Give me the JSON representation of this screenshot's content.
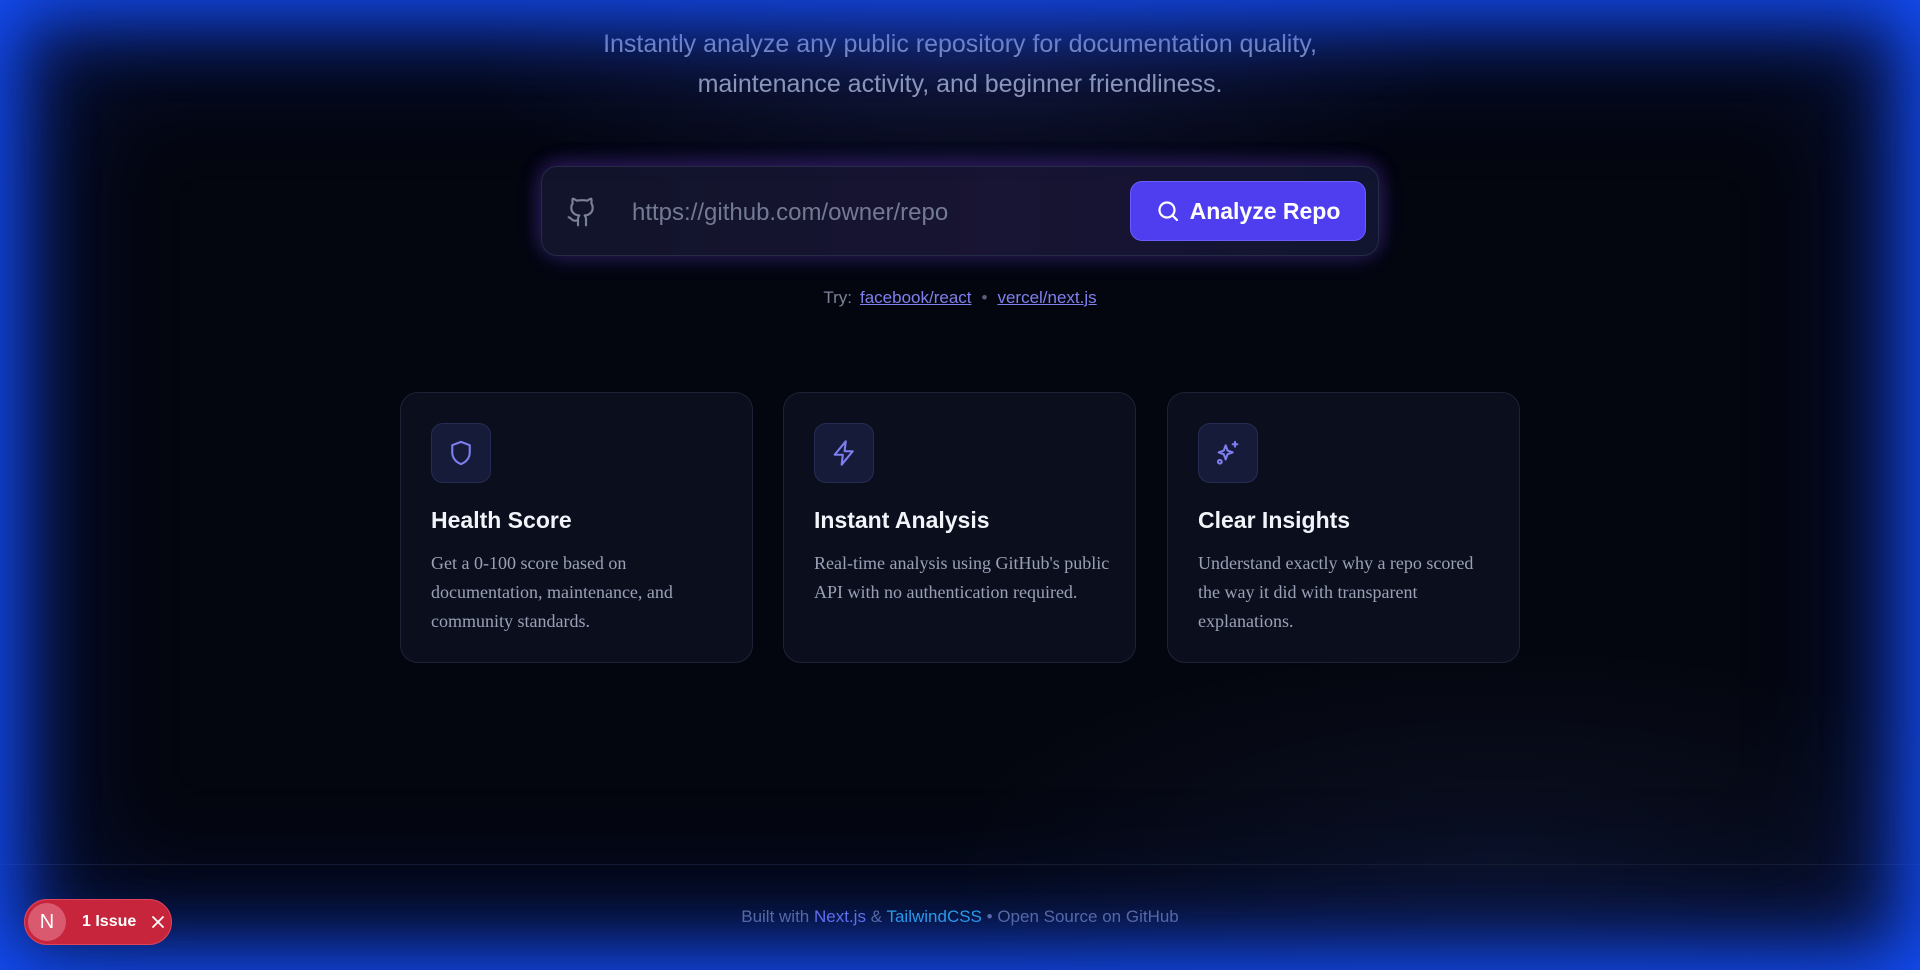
{
  "hero": {
    "subtitle_line1": "Instantly analyze any public repository for documentation quality,",
    "subtitle_line2": "maintenance activity, and beginner friendliness."
  },
  "search": {
    "icon": "github-icon",
    "placeholder": "https://github.com/owner/repo",
    "value": "",
    "button_label": "Analyze Repo",
    "button_icon": "search-icon"
  },
  "examples": {
    "label": "Try:",
    "items": [
      "facebook/react",
      "vercel/next.js"
    ],
    "separator": "•"
  },
  "features": [
    {
      "icon": "shield-icon",
      "title": "Health Score",
      "description": "Get a 0-100 score based on documentation, maintenance, and community standards."
    },
    {
      "icon": "lightning-icon",
      "title": "Instant Analysis",
      "description": "Real-time analysis using GitHub's public API with no authentication required."
    },
    {
      "icon": "sparkles-icon",
      "title": "Clear Insights",
      "description": "Understand exactly why a repo scored the way it did with transparent explanations."
    }
  ],
  "footer": {
    "prefix": "Built with",
    "nextjs": "Next.js",
    "amp": "&",
    "tailwind": "TailwindCSS",
    "suffix": "• Open Source on GitHub"
  },
  "dev_indicator": {
    "avatar_letter": "N",
    "label": "1 Issue"
  },
  "colors": {
    "accent": "#4f3ef0",
    "link": "#7f80ee",
    "tailwind": "#35b8e8",
    "issue_badge": "#c7253c",
    "background": "#04060f"
  }
}
